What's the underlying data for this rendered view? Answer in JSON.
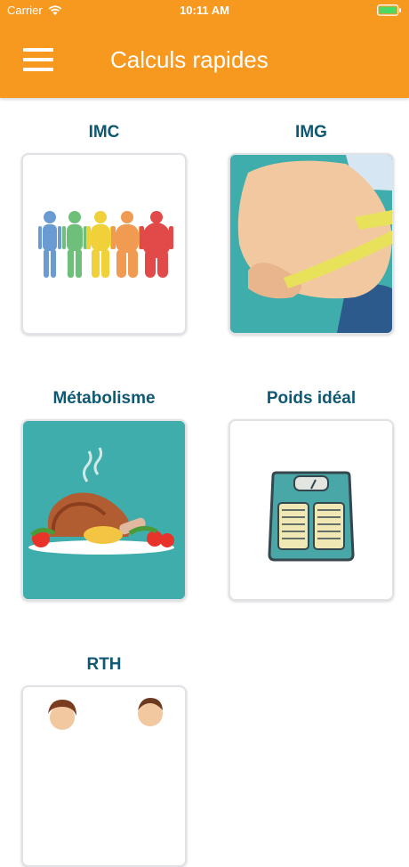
{
  "status": {
    "carrier": "Carrier",
    "time": "10:11 AM"
  },
  "header": {
    "title": "Calculs rapides"
  },
  "tiles": [
    {
      "label": "IMC"
    },
    {
      "label": "IMG"
    },
    {
      "label": "Métabolisme"
    },
    {
      "label": "Poids idéal"
    },
    {
      "label": "RTH"
    }
  ],
  "colors": {
    "brand": "#f7981f",
    "label": "#0f5873",
    "teal": "#3fadab"
  }
}
